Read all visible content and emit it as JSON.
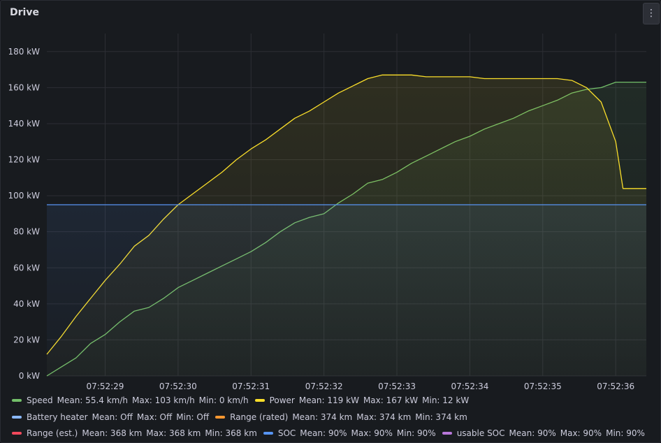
{
  "panel": {
    "title": "Drive",
    "menu_icon": "⋮"
  },
  "chart_data": {
    "type": "line",
    "ylim": [
      0,
      190
    ],
    "yticks": [
      0,
      20,
      40,
      60,
      80,
      100,
      120,
      140,
      160,
      180
    ],
    "y_unit": "kW",
    "xlim": [
      "07:52:28.2",
      "07:52:36.42"
    ],
    "xtick_labels": [
      "07:52:29",
      "07:52:30",
      "07:52:31",
      "07:52:32",
      "07:52:33",
      "07:52:34",
      "07:52:35",
      "07:52:36"
    ],
    "grid": true,
    "legend_placement": "bottom",
    "series": [
      {
        "name": "Speed",
        "color": "#73bf69",
        "x": [
          28.2,
          28.4,
          28.6,
          28.8,
          29.0,
          29.2,
          29.4,
          29.6,
          29.8,
          30.0,
          30.2,
          30.4,
          30.6,
          30.8,
          31.0,
          31.2,
          31.4,
          31.6,
          31.8,
          32.0,
          32.2,
          32.4,
          32.6,
          32.8,
          33.0,
          33.2,
          33.4,
          33.6,
          33.8,
          34.0,
          34.2,
          34.4,
          34.6,
          34.8,
          35.0,
          35.2,
          35.4,
          35.6,
          35.8,
          36.0,
          36.2,
          36.42
        ],
        "y": [
          0,
          5,
          10,
          18,
          23,
          30,
          36,
          38,
          43,
          49,
          53,
          57,
          61,
          65,
          69,
          74,
          80,
          85,
          88,
          90,
          96,
          101,
          107,
          109,
          113,
          118,
          122,
          126,
          130,
          133,
          137,
          140,
          143,
          147,
          150,
          153,
          157,
          159,
          160,
          163,
          163,
          163
        ]
      },
      {
        "name": "Power",
        "color": "#fade2a",
        "x": [
          28.2,
          28.4,
          28.6,
          28.8,
          29.0,
          29.2,
          29.4,
          29.6,
          29.8,
          30.0,
          30.2,
          30.4,
          30.6,
          30.8,
          31.0,
          31.2,
          31.4,
          31.6,
          31.8,
          32.0,
          32.2,
          32.4,
          32.6,
          32.8,
          33.0,
          33.2,
          33.4,
          33.6,
          33.8,
          34.0,
          34.2,
          34.4,
          34.6,
          34.8,
          35.0,
          35.2,
          35.4,
          35.6,
          35.8,
          36.0,
          36.1,
          36.2,
          36.3,
          36.42
        ],
        "y": [
          12,
          22,
          33,
          43,
          53,
          62,
          72,
          78,
          87,
          95,
          101,
          107,
          113,
          120,
          126,
          131,
          137,
          143,
          147,
          152,
          157,
          161,
          165,
          167,
          167,
          167,
          166,
          166,
          166,
          166,
          165,
          165,
          165,
          165,
          165,
          165,
          164,
          160,
          152,
          130,
          104,
          104,
          104,
          104
        ]
      },
      {
        "name": "SOC",
        "color": "#5794f2",
        "x": [
          28.2,
          36.42
        ],
        "y": [
          95,
          95
        ]
      }
    ],
    "legend": [
      [
        {
          "name": "Speed",
          "color": "#73bf69",
          "stats": [
            "Mean: 55.4 km/h",
            "Max: 103 km/h",
            "Min: 0 km/h"
          ]
        },
        {
          "name": "Power",
          "color": "#fade2a",
          "stats": [
            "Mean: 119 kW",
            "Max: 167 kW",
            "Min: 12 kW"
          ]
        }
      ],
      [
        {
          "name": "Battery heater",
          "color": "#8ab8ff",
          "stats": [
            "Mean: Off",
            "Max: Off",
            "Min: Off"
          ]
        },
        {
          "name": "Range (rated)",
          "color": "#ff9830",
          "stats": [
            "Mean: 374 km",
            "Max: 374 km",
            "Min: 374 km"
          ]
        }
      ],
      [
        {
          "name": "Range (est.)",
          "color": "#f2495c",
          "stats": [
            "Mean: 368 km",
            "Max: 368 km",
            "Min: 368 km"
          ]
        },
        {
          "name": "SOC",
          "color": "#5794f2",
          "stats": [
            "Mean: 90%",
            "Max: 90%",
            "Min: 90%"
          ]
        },
        {
          "name": "usable SOC",
          "color": "#b877d9",
          "stats": [
            "Mean: 90%",
            "Max: 90%",
            "Min: 90%"
          ]
        }
      ]
    ]
  }
}
